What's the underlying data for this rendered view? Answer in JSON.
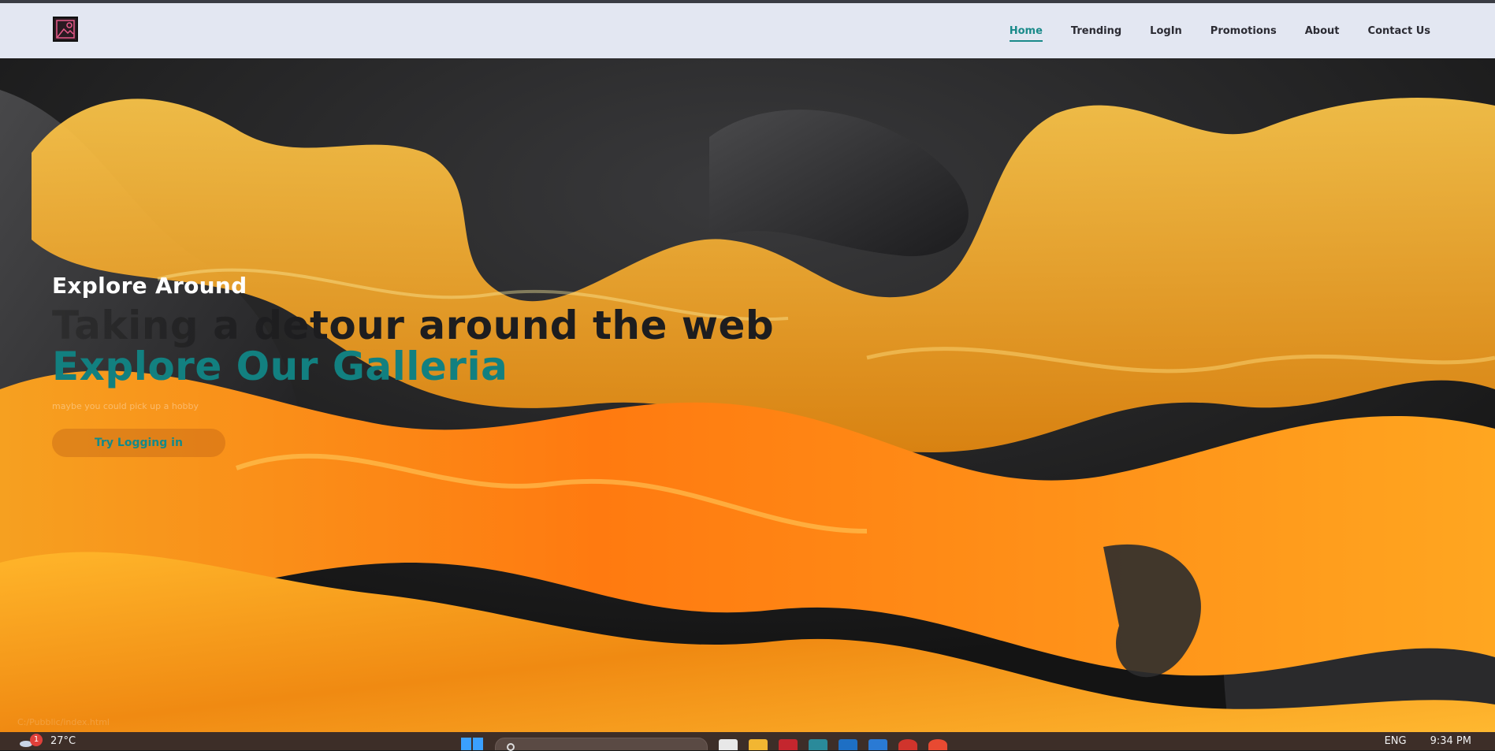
{
  "nav": {
    "logo_alt": "image-logo",
    "links": [
      {
        "label": "Home",
        "active": true
      },
      {
        "label": "Trending"
      },
      {
        "label": "LogIn"
      },
      {
        "label": "Promotions"
      },
      {
        "label": "About"
      },
      {
        "label": "Contact Us"
      }
    ]
  },
  "hero": {
    "eyebrow": "Explore Around",
    "headline_faded": "Taking a de",
    "headline_rest": "tour around the web",
    "headline2": "Explore Our Galleria",
    "tagline": "maybe you could pick up a hobby",
    "cta_label": "Try Logging in",
    "status_url": "C:/Pubblic/index.html"
  },
  "taskbar": {
    "weather_badge": "1",
    "temperature": "27°C",
    "language": "ENG",
    "time": "9:34 PM"
  },
  "colors": {
    "accent": "#128080",
    "nav_bg": "#e3e7f2",
    "taskbar_bg": "#3d2e28"
  }
}
